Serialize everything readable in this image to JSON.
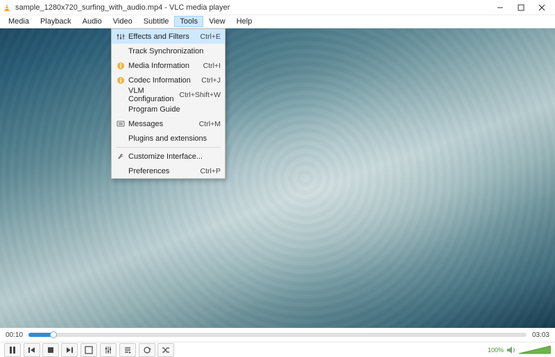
{
  "title": "sample_1280x720_surfing_with_audio.mp4 - VLC media player",
  "menubar": [
    "Media",
    "Playback",
    "Audio",
    "Video",
    "Subtitle",
    "Tools",
    "View",
    "Help"
  ],
  "open_menu_index": 5,
  "tools_menu": {
    "effects": {
      "label": "Effects and Filters",
      "shortcut": "Ctrl+E",
      "icon": "sliders",
      "hl": true
    },
    "tracksync": {
      "label": "Track Synchronization",
      "shortcut": "",
      "icon": ""
    },
    "mediainfo": {
      "label": "Media Information",
      "shortcut": "Ctrl+I",
      "icon": "warn"
    },
    "codecinfo": {
      "label": "Codec Information",
      "shortcut": "Ctrl+J",
      "icon": "warn"
    },
    "vlm": {
      "label": "VLM Configuration",
      "shortcut": "Ctrl+Shift+W",
      "icon": ""
    },
    "program": {
      "label": "Program Guide",
      "shortcut": "",
      "icon": ""
    },
    "messages": {
      "label": "Messages",
      "shortcut": "Ctrl+M",
      "icon": "msg"
    },
    "plugins": {
      "label": "Plugins and extensions",
      "shortcut": "",
      "icon": ""
    },
    "customize": {
      "label": "Customize Interface...",
      "shortcut": "",
      "icon": "wrench"
    },
    "prefs": {
      "label": "Preferences",
      "shortcut": "Ctrl+P",
      "icon": ""
    }
  },
  "time": {
    "current": "00:10",
    "total": "03:03"
  },
  "volume": {
    "percent": "100%"
  }
}
